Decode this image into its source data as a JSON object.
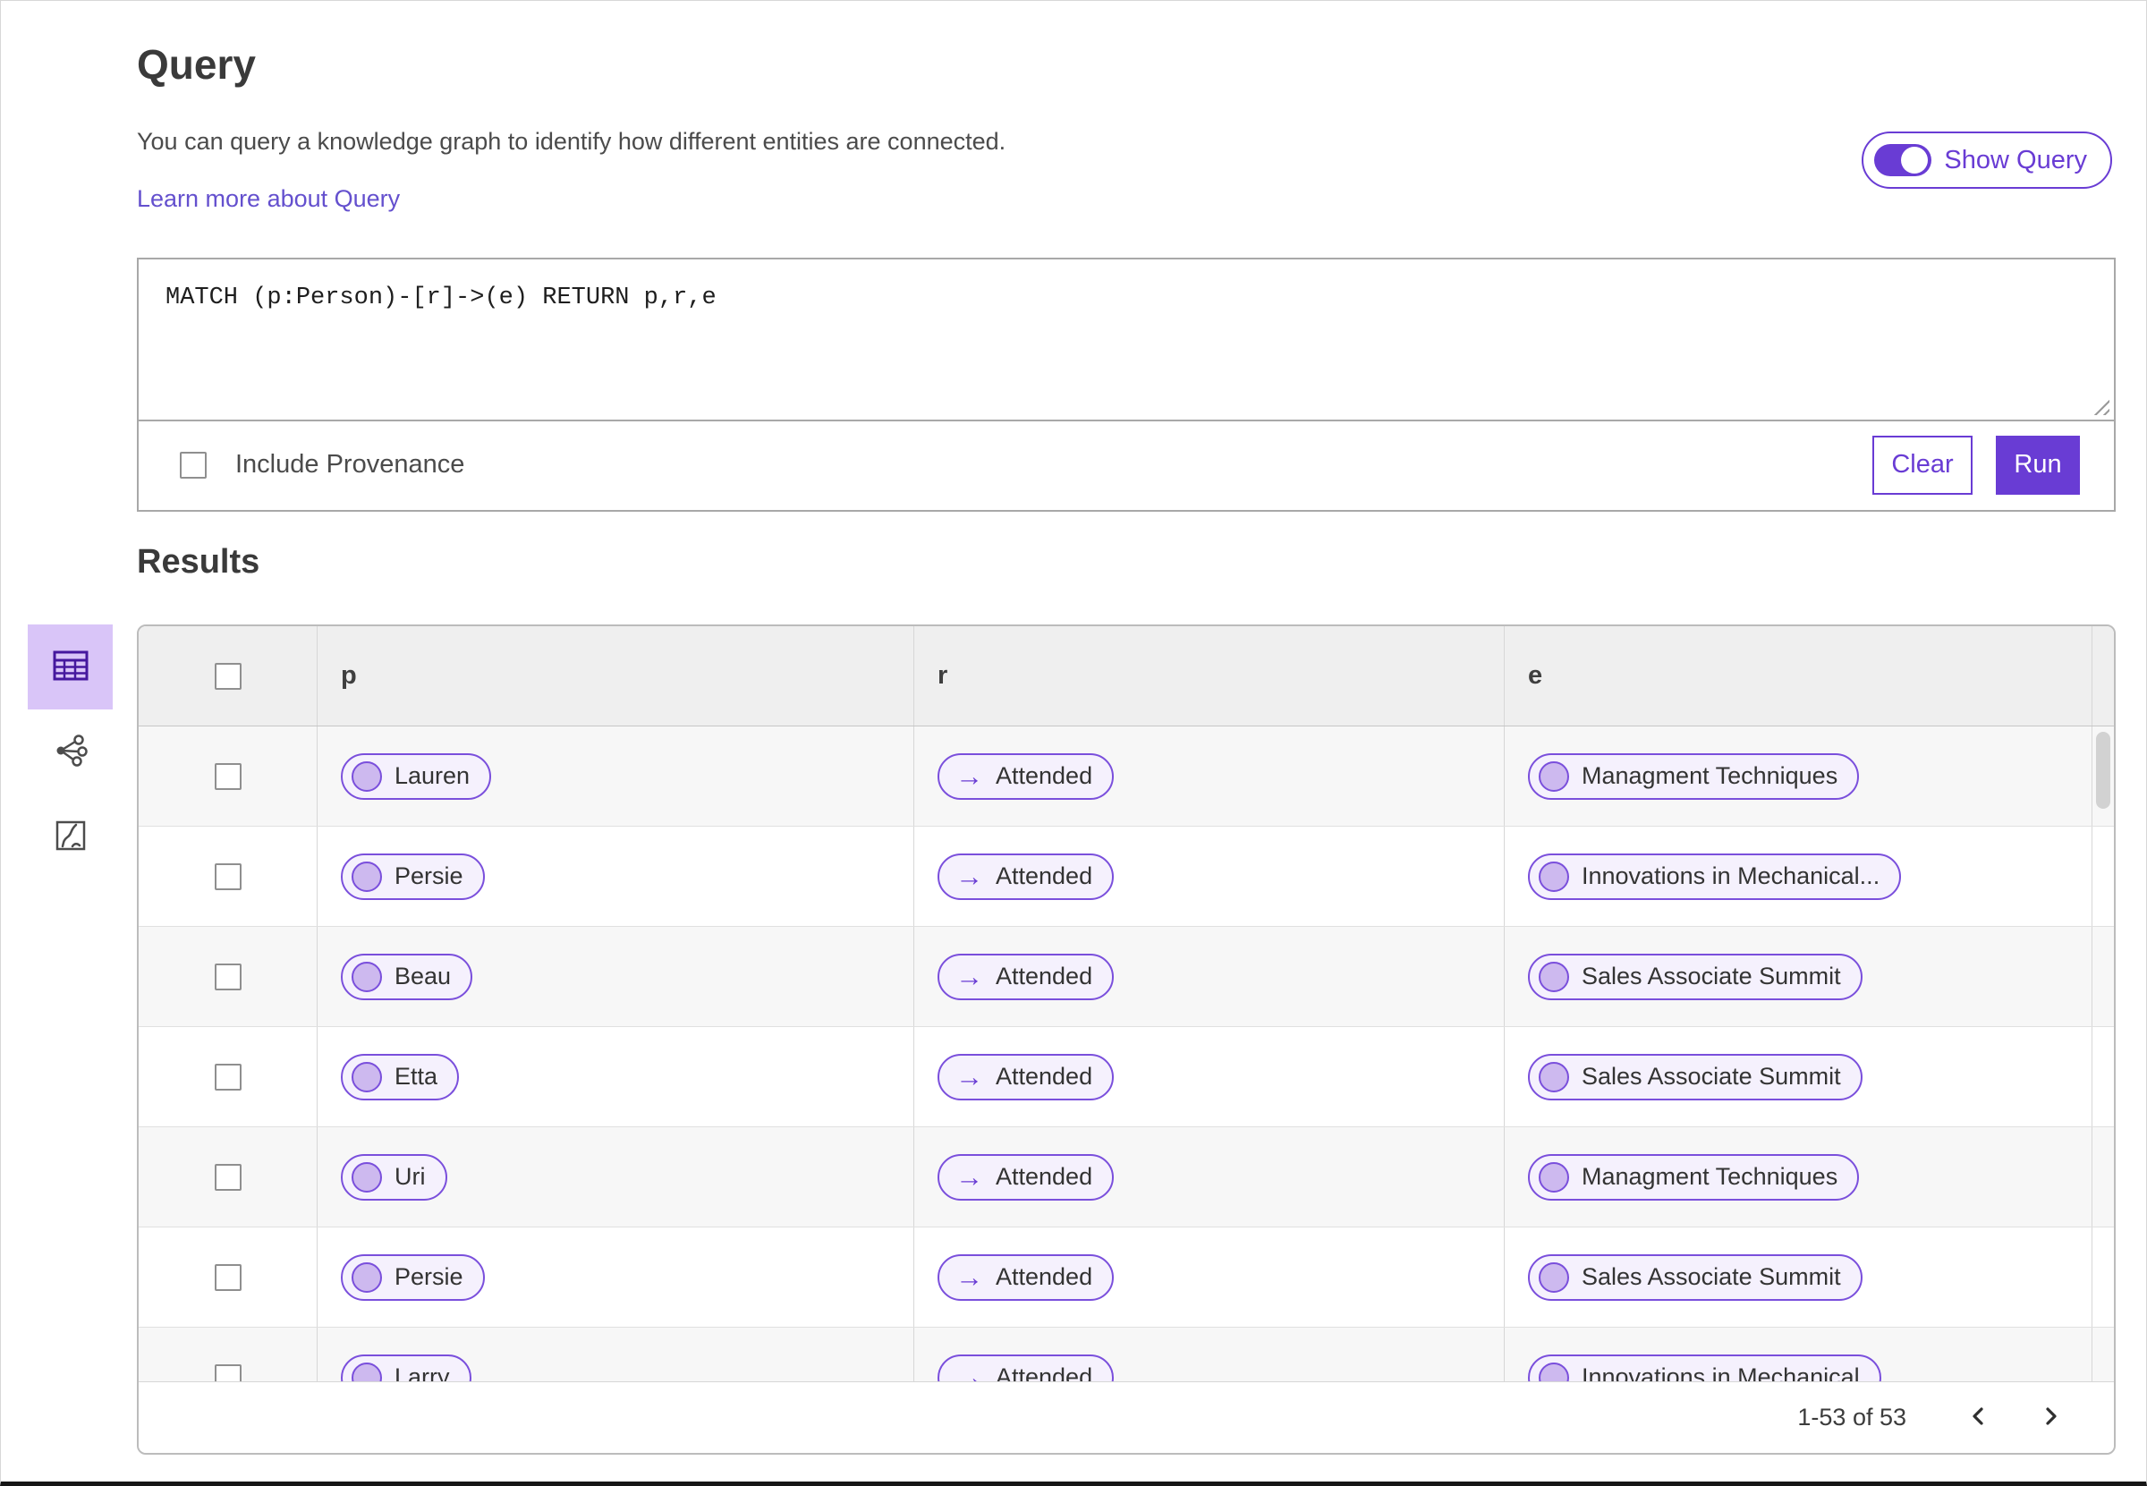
{
  "page": {
    "title": "Query",
    "description": "You can query a knowledge graph to identify how different entities are connected.",
    "learn_more_link": "Learn more about Query",
    "show_query_label": "Show Query",
    "show_query_on": true
  },
  "query_editor": {
    "text": "MATCH (p:Person)-[r]->(e) RETURN p,r,e",
    "include_provenance_label": "Include Provenance",
    "include_provenance_checked": false,
    "clear_label": "Clear",
    "run_label": "Run"
  },
  "results": {
    "title": "Results"
  },
  "view_switcher": {
    "selected": "table",
    "options": [
      "table-view",
      "network-view",
      "chart-view"
    ]
  },
  "table": {
    "columns": [
      "p",
      "r",
      "e"
    ],
    "relation_arrow": "→",
    "rows": [
      {
        "p": "Lauren",
        "r": "Attended",
        "e": "Managment Techniques"
      },
      {
        "p": "Persie",
        "r": "Attended",
        "e": "Innovations in Mechanical..."
      },
      {
        "p": "Beau",
        "r": "Attended",
        "e": "Sales Associate Summit"
      },
      {
        "p": "Etta",
        "r": "Attended",
        "e": "Sales Associate Summit"
      },
      {
        "p": "Uri",
        "r": "Attended",
        "e": "Managment Techniques"
      },
      {
        "p": "Persie",
        "r": "Attended",
        "e": "Sales Associate Summit"
      },
      {
        "p": "Larry",
        "r": "Attended",
        "e": "Innovations in Mechanical"
      }
    ]
  },
  "pagination": {
    "range_label": "1-53 of 53"
  },
  "colors": {
    "primary_purple": "#693cd4",
    "pill_border": "#7a4fdc",
    "pill_bg": "#f5f1fd",
    "node_fill": "#cdb9ef",
    "selected_tile_bg": "#d9c5f8",
    "link": "#6450ce",
    "icon_dark_purple": "#45189e"
  }
}
